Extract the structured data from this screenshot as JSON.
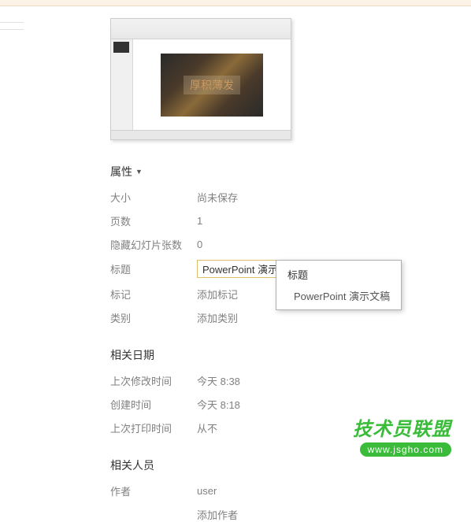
{
  "thumbnail": {
    "slide_text": "厚积薄发"
  },
  "properties": {
    "header": "属性",
    "size": {
      "label": "大小",
      "value": "尚未保存"
    },
    "pages": {
      "label": "页数",
      "value": "1"
    },
    "hidden_slides": {
      "label": "隐藏幻灯片张数",
      "value": "0"
    },
    "title": {
      "label": "标题",
      "value": "PowerPoint 演示文稿"
    },
    "tags": {
      "label": "标记",
      "placeholder": "添加标记"
    },
    "category": {
      "label": "类别",
      "placeholder": "添加类别"
    }
  },
  "dates": {
    "header": "相关日期",
    "modified": {
      "label": "上次修改时间",
      "value": "今天 8:38"
    },
    "created": {
      "label": "创建时间",
      "value": "今天 8:18"
    },
    "printed": {
      "label": "上次打印时间",
      "value": "从不"
    }
  },
  "people": {
    "header": "相关人员",
    "author": {
      "label": "作者",
      "value": "user",
      "add": "添加作者"
    }
  },
  "tooltip": {
    "title": "标题",
    "value": "PowerPoint 演示文稿"
  },
  "watermark": {
    "cn": "技术员联盟",
    "url": "www.jsgho.com"
  }
}
